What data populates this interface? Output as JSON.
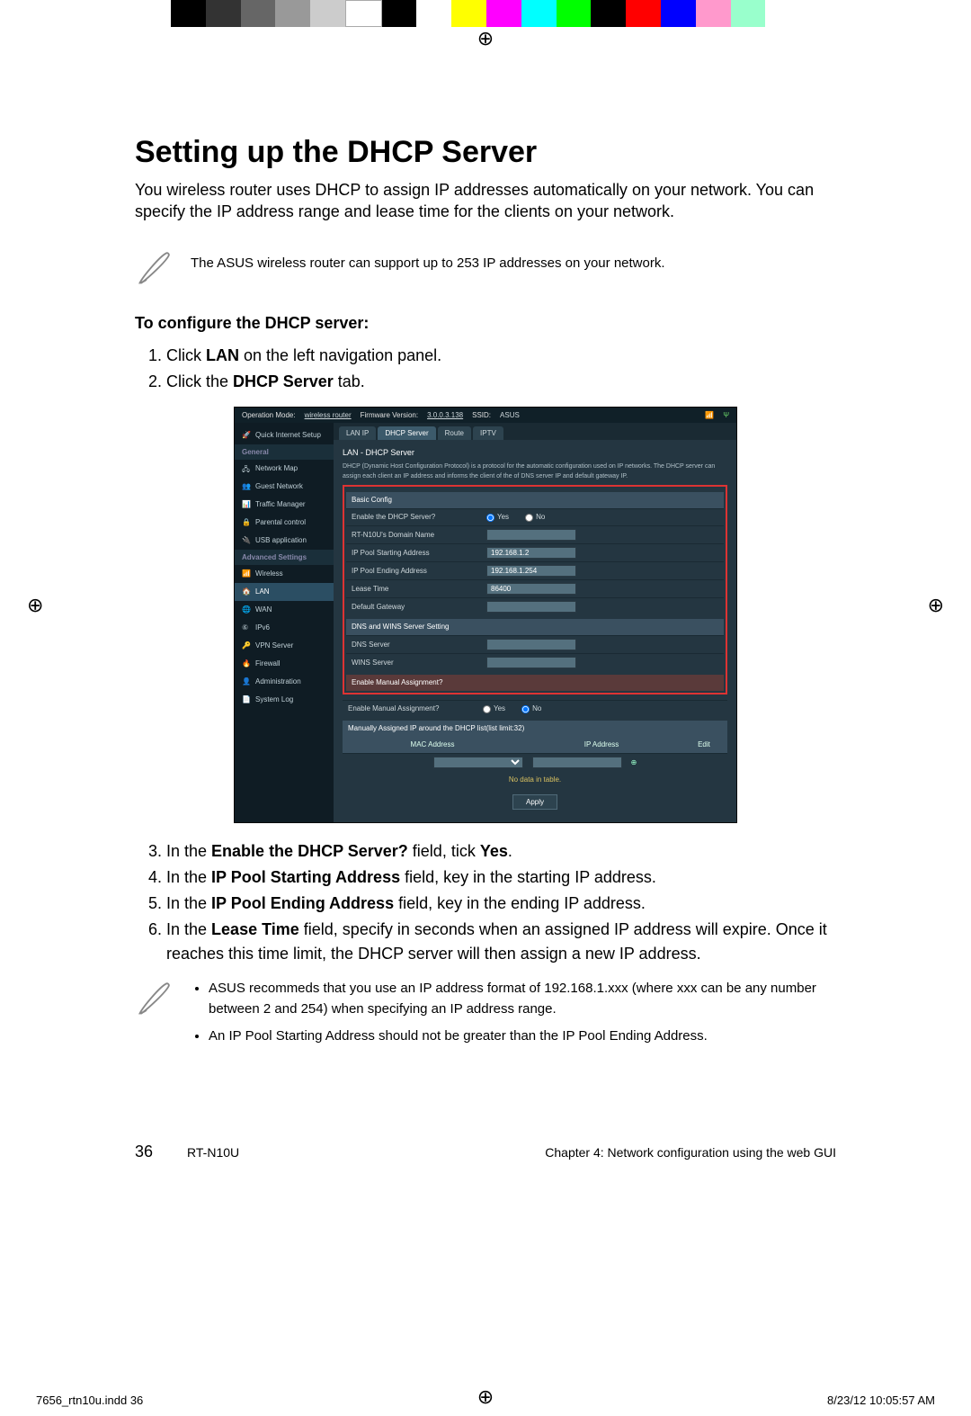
{
  "colorbar": [
    "#000000",
    "#333333",
    "#666666",
    "#999999",
    "#cccccc",
    "#ffffff",
    "#000000",
    "#ffffff",
    "#ffff00",
    "#ff00ff",
    "#00ffff",
    "#00ff00",
    "#000000",
    "#ff0000",
    "#0000ff",
    "#ff99cc",
    "#99ffcc",
    "#ffffff"
  ],
  "heading": "Setting up the DHCP Server",
  "intro": "You wireless router uses DHCP to assign IP addresses automatically on your network. You can specify the IP address range and lease time for the clients on your network.",
  "note1": "The ASUS wireless router can support up to 253 IP addresses on your network.",
  "subhead": "To configure the DHCP server:",
  "steps_a": [
    {
      "pre": "Click ",
      "b": "LAN",
      "post": " on the left navigation panel."
    },
    {
      "pre": "Click the ",
      "b": "DHCP Server",
      "post": " tab."
    }
  ],
  "steps_b": [
    {
      "pre": "In the ",
      "b": "Enable the DHCP Server?",
      "post": " field, tick ",
      "b2": "Yes",
      "post2": "."
    },
    {
      "pre": "In the ",
      "b": "IP Pool Starting Address",
      "post": " field, key in the starting IP address."
    },
    {
      "pre": "In the ",
      "b": "IP Pool Ending Address",
      "post": " field, key in the ending IP address."
    },
    {
      "pre": "In the ",
      "b": "Lease Time",
      "post": " field, specify in seconds when an assigned IP address will expire. Once it reaches this time limit, the DHCP server will then assign a new IP address."
    }
  ],
  "note2": [
    "ASUS recommeds that you use an IP address format of 192.168.1.xxx (where xxx can be any number between 2 and 254) when specifying an IP address range.",
    "An IP Pool Starting Address should not be greater than the IP Pool Ending Address."
  ],
  "router": {
    "topbar": {
      "opmode_lbl": "Operation Mode:",
      "opmode_val": "wireless router",
      "fw_lbl": "Firmware Version:",
      "fw_val": "3.0.0.3.138",
      "ssid_lbl": "SSID:",
      "ssid_val": "ASUS"
    },
    "quick": "Quick Internet Setup",
    "sidebar_general_hdr": "General",
    "sidebar_general": [
      "Network Map",
      "Guest Network",
      "Traffic Manager",
      "Parental control",
      "USB application"
    ],
    "sidebar_adv_hdr": "Advanced Settings",
    "sidebar_adv": [
      "Wireless",
      "LAN",
      "WAN",
      "IPv6",
      "VPN Server",
      "Firewall",
      "Administration",
      "System Log"
    ],
    "sidebar_active": "LAN",
    "tabs": [
      "LAN IP",
      "DHCP Server",
      "Route",
      "IPTV"
    ],
    "tab_active": "DHCP Server",
    "panel_title": "LAN - DHCP Server",
    "panel_desc": "DHCP (Dynamic Host Configuration Protocol) is a protocol for the automatic configuration used on IP networks. The DHCP server can assign each client an IP address and informs the client of the of DNS server IP and default gateway IP.",
    "manual_link": "Manually assigned IP around the DHCP list(list limit:32)",
    "basic_hdr": "Basic Config",
    "fields": {
      "enable_lbl": "Enable the DHCP Server?",
      "yes": "Yes",
      "no": "No",
      "domain_lbl": "RT-N10U's Domain Name",
      "domain_val": "",
      "start_lbl": "IP Pool Starting Address",
      "start_val": "192.168.1.2",
      "end_lbl": "IP Pool Ending Address",
      "end_val": "192.168.1.254",
      "lease_lbl": "Lease Time",
      "lease_val": "86400",
      "gw_lbl": "Default Gateway",
      "gw_val": ""
    },
    "dns_hdr": "DNS and WINS Server Setting",
    "dns_lbl": "DNS Server",
    "wins_lbl": "WINS Server",
    "manual_hdr": "Enable Manual Assignment?",
    "manual_enable_lbl": "Enable Manual Assignment?",
    "assign_hdr": "Manually Assigned IP around the DHCP list(list limit:32)",
    "col_mac": "MAC Address",
    "col_ip": "IP Address",
    "col_edit": "Edit",
    "nodata": "No data in table.",
    "apply": "Apply"
  },
  "footer": {
    "pagenum": "36",
    "model": "RT-N10U",
    "chapter": "Chapter 4: Network configuration using the web GUI"
  },
  "printmeta": {
    "file": "7656_rtn10u.indd   36",
    "time": "8/23/12   10:05:57 AM"
  }
}
